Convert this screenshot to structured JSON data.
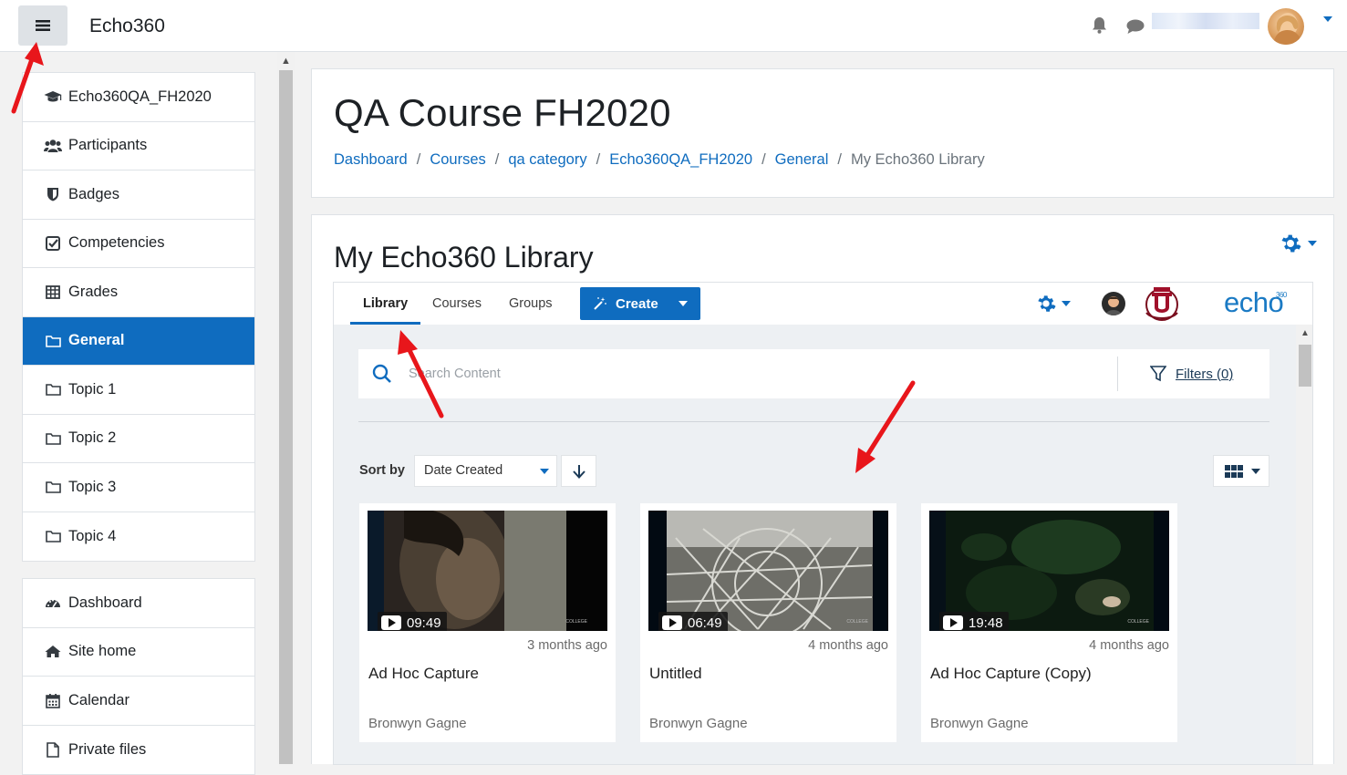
{
  "navbar": {
    "brand": "Echo360",
    "icons": [
      "menu-icon",
      "bell-icon",
      "chat-icon"
    ]
  },
  "sidebar": {
    "group1": [
      {
        "label": "Echo360QA_FH2020",
        "icon": "graduation-cap-icon"
      },
      {
        "label": "Participants",
        "icon": "users-icon"
      },
      {
        "label": "Badges",
        "icon": "shield-icon"
      },
      {
        "label": "Competencies",
        "icon": "check-square-icon"
      },
      {
        "label": "Grades",
        "icon": "table-icon"
      },
      {
        "label": "General",
        "icon": "folder-icon",
        "active": true
      },
      {
        "label": "Topic 1",
        "icon": "folder-icon"
      },
      {
        "label": "Topic 2",
        "icon": "folder-icon"
      },
      {
        "label": "Topic 3",
        "icon": "folder-icon"
      },
      {
        "label": "Topic 4",
        "icon": "folder-icon"
      }
    ],
    "group2": [
      {
        "label": "Dashboard",
        "icon": "dashboard-icon"
      },
      {
        "label": "Site home",
        "icon": "home-icon"
      },
      {
        "label": "Calendar",
        "icon": "calendar-icon"
      },
      {
        "label": "Private files",
        "icon": "file-icon"
      }
    ]
  },
  "header": {
    "title": "QA Course FH2020",
    "breadcrumb": [
      "Dashboard",
      "Courses",
      "qa category",
      "Echo360QA_FH2020",
      "General"
    ],
    "breadcrumb_current": "My Echo360 Library",
    "separator": "/"
  },
  "library": {
    "title": "My Echo360 Library",
    "tabs": [
      "Library",
      "Courses",
      "Groups"
    ],
    "create_label": "Create",
    "logo_text": "echo",
    "logo_sup": "360",
    "search_placeholder": "Search Content",
    "filters_label": "Filters (0)",
    "sort_label": "Sort by",
    "sort_value": "Date Created",
    "media": [
      {
        "duration": "09:49",
        "ago": "3 months ago",
        "title": "Ad Hoc Capture",
        "owner": "Bronwyn Gagne",
        "tag": "COLLEGE"
      },
      {
        "duration": "06:49",
        "ago": "4 months ago",
        "title": "Untitled",
        "owner": "Bronwyn Gagne",
        "tag": "COLLEGE"
      },
      {
        "duration": "19:48",
        "ago": "4 months ago",
        "title": "Ad Hoc Capture (Copy)",
        "owner": "Bronwyn Gagne",
        "tag": "COLLEGE"
      }
    ]
  },
  "colors": {
    "accent": "#0f6cbf",
    "arrow": "#e8161b"
  }
}
